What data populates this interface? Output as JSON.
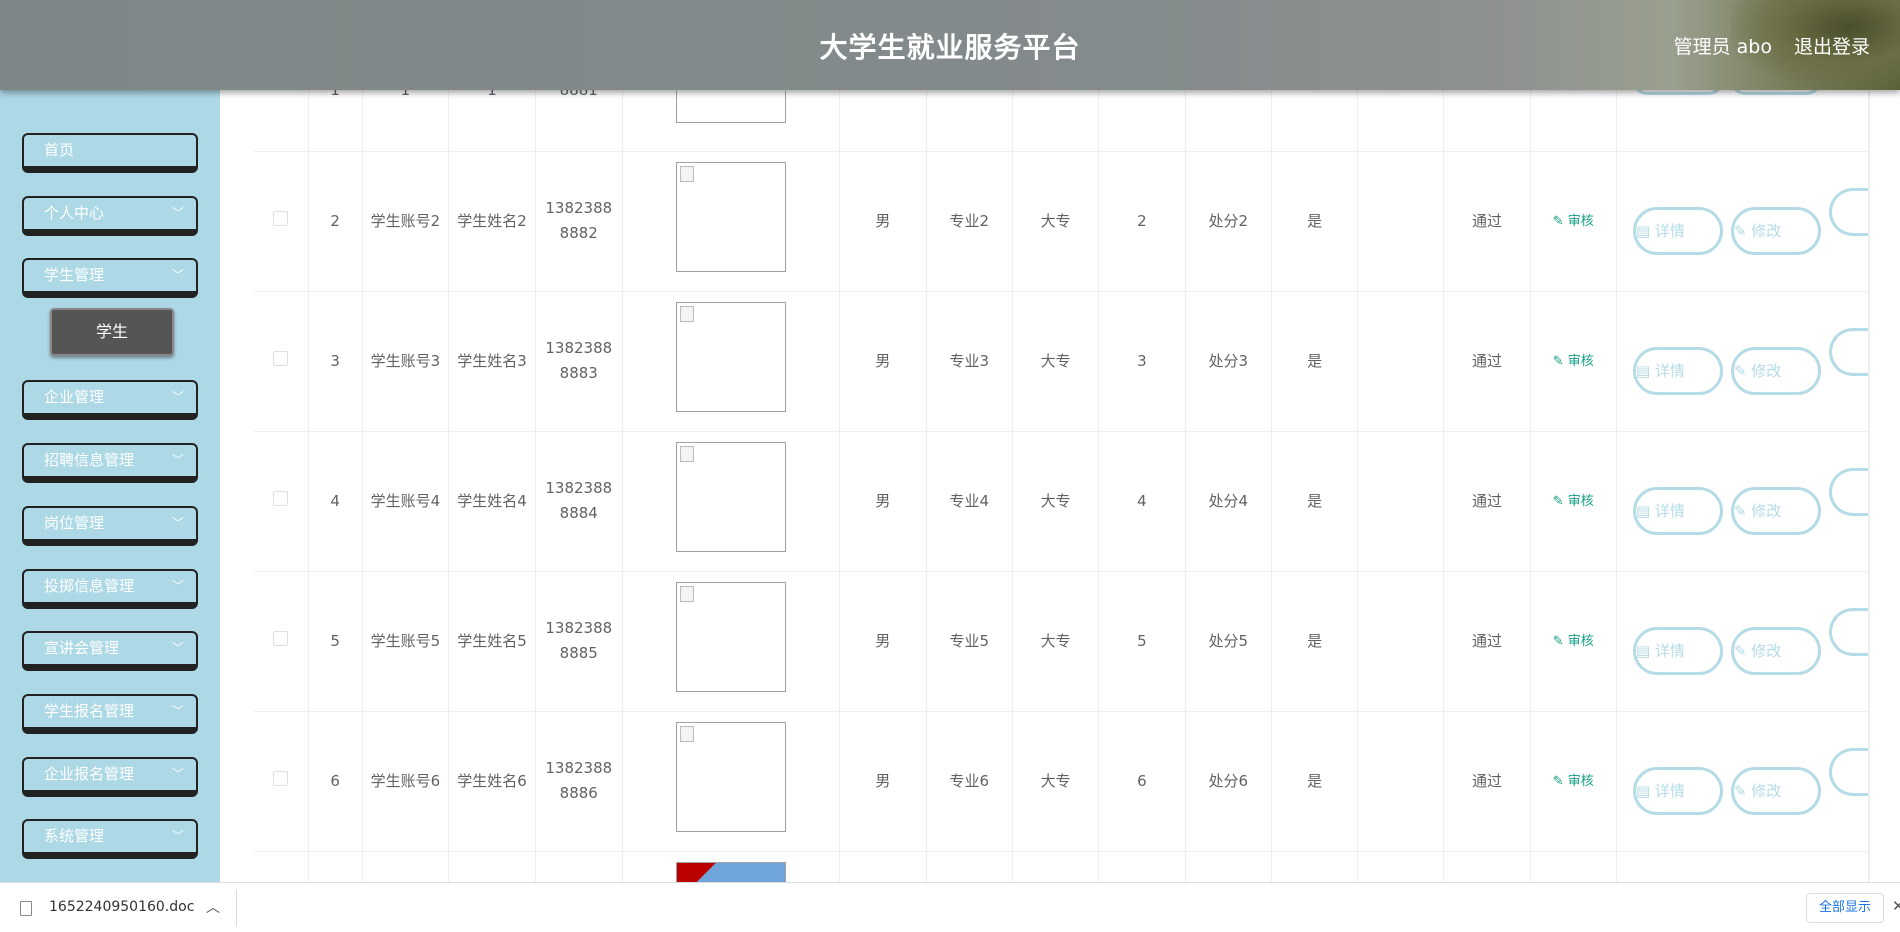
{
  "header": {
    "title": "大学生就业服务平台",
    "user_label": "管理员 abo",
    "logout_label": "退出登录"
  },
  "sidebar": {
    "items": [
      {
        "label": "首页"
      },
      {
        "label": "个人中心"
      },
      {
        "label": "学生管理"
      },
      {
        "label": "企业管理"
      },
      {
        "label": "招聘信息管理"
      },
      {
        "label": "岗位管理"
      },
      {
        "label": "投掷信息管理"
      },
      {
        "label": "宣讲会管理"
      },
      {
        "label": "学生报名管理"
      },
      {
        "label": "企业报名管理"
      },
      {
        "label": "系统管理"
      }
    ],
    "submenu_active": "学生"
  },
  "table": {
    "partial_top": {
      "no": "1",
      "account": "1",
      "name": "1",
      "phone": "8881"
    },
    "rows": [
      {
        "no": "2",
        "account": "学生账号2",
        "name": "学生姓名2",
        "phone": "13823888882",
        "gender": "男",
        "major": "专业2",
        "edu": "大专",
        "num": "2",
        "punish": "处分2",
        "flag": "是",
        "status": "通过",
        "audit": "审核",
        "detail": "详情",
        "edit": "修改"
      },
      {
        "no": "3",
        "account": "学生账号3",
        "name": "学生姓名3",
        "phone": "13823888883",
        "gender": "男",
        "major": "专业3",
        "edu": "大专",
        "num": "3",
        "punish": "处分3",
        "flag": "是",
        "status": "通过",
        "audit": "审核",
        "detail": "详情",
        "edit": "修改"
      },
      {
        "no": "4",
        "account": "学生账号4",
        "name": "学生姓名4",
        "phone": "13823888884",
        "gender": "男",
        "major": "专业4",
        "edu": "大专",
        "num": "4",
        "punish": "处分4",
        "flag": "是",
        "status": "通过",
        "audit": "审核",
        "detail": "详情",
        "edit": "修改"
      },
      {
        "no": "5",
        "account": "学生账号5",
        "name": "学生姓名5",
        "phone": "13823888885",
        "gender": "男",
        "major": "专业5",
        "edu": "大专",
        "num": "5",
        "punish": "处分5",
        "flag": "是",
        "status": "通过",
        "audit": "审核",
        "detail": "详情",
        "edit": "修改"
      },
      {
        "no": "6",
        "account": "学生账号6",
        "name": "学生姓名6",
        "phone": "13823888886",
        "gender": "男",
        "major": "专业6",
        "edu": "大专",
        "num": "6",
        "punish": "处分6",
        "flag": "是",
        "status": "通过",
        "audit": "审核",
        "detail": "详情",
        "edit": "修改"
      }
    ]
  },
  "download_bar": {
    "filename": "1652240950160.doc",
    "show_all": "全部显示"
  },
  "icons": {
    "chevron": "chevron-down-icon",
    "audit": "pencil-icon",
    "detail": "document-icon",
    "edit": "pencil-icon",
    "file": "file-icon",
    "caret": "chevron-up-icon",
    "close": "close-icon"
  },
  "colors": {
    "sidebar_bg": "#add8e6",
    "audit_green": "#16a085",
    "pill_border": "#b5dbe6"
  }
}
